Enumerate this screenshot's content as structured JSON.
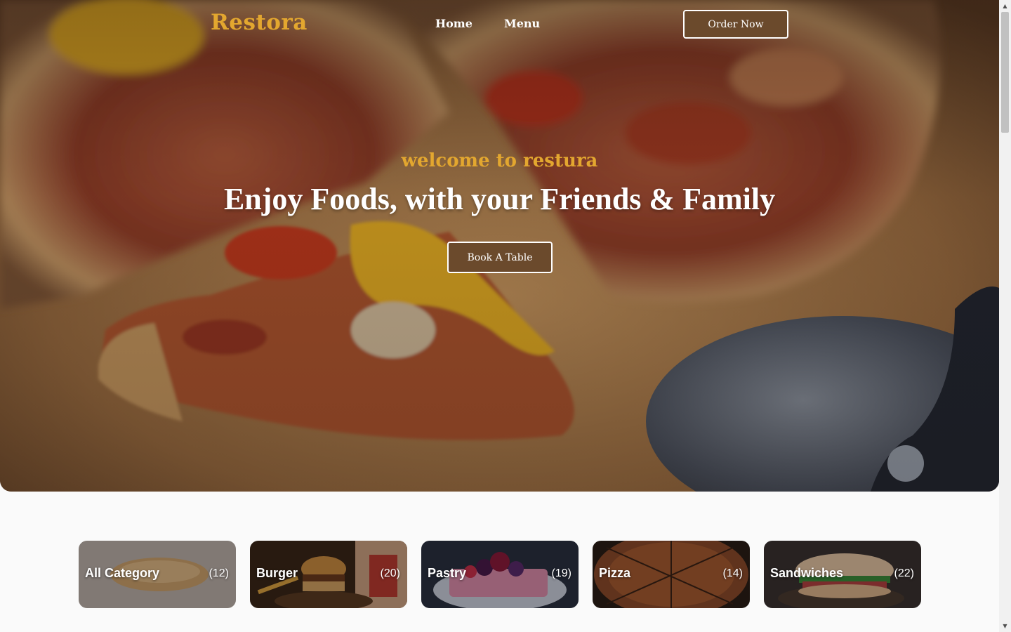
{
  "brand": {
    "logo": "Restora",
    "accent_color": "#e3a72f"
  },
  "nav": {
    "links": [
      {
        "label": "Home"
      },
      {
        "label": "Menu"
      }
    ],
    "order_button": "Order Now"
  },
  "hero": {
    "subtitle": "welcome to restura",
    "title": "Enjoy Foods, with your Friends & Family",
    "cta": "Book A Table",
    "background_image": "pizza-on-wooden-board"
  },
  "categories": [
    {
      "name": "All Category",
      "count": "(12)",
      "image": "bread-loaf"
    },
    {
      "name": "Burger",
      "count": "(20)",
      "image": "burger-with-fries"
    },
    {
      "name": "Pastry",
      "count": "(19)",
      "image": "berry-pastry"
    },
    {
      "name": "Pizza",
      "count": "(14)",
      "image": "sliced-pizza"
    },
    {
      "name": "Sandwiches",
      "count": "(22)",
      "image": "sandwich"
    }
  ],
  "scrollbar": {
    "up_icon": "▲",
    "down_icon": "▼"
  }
}
